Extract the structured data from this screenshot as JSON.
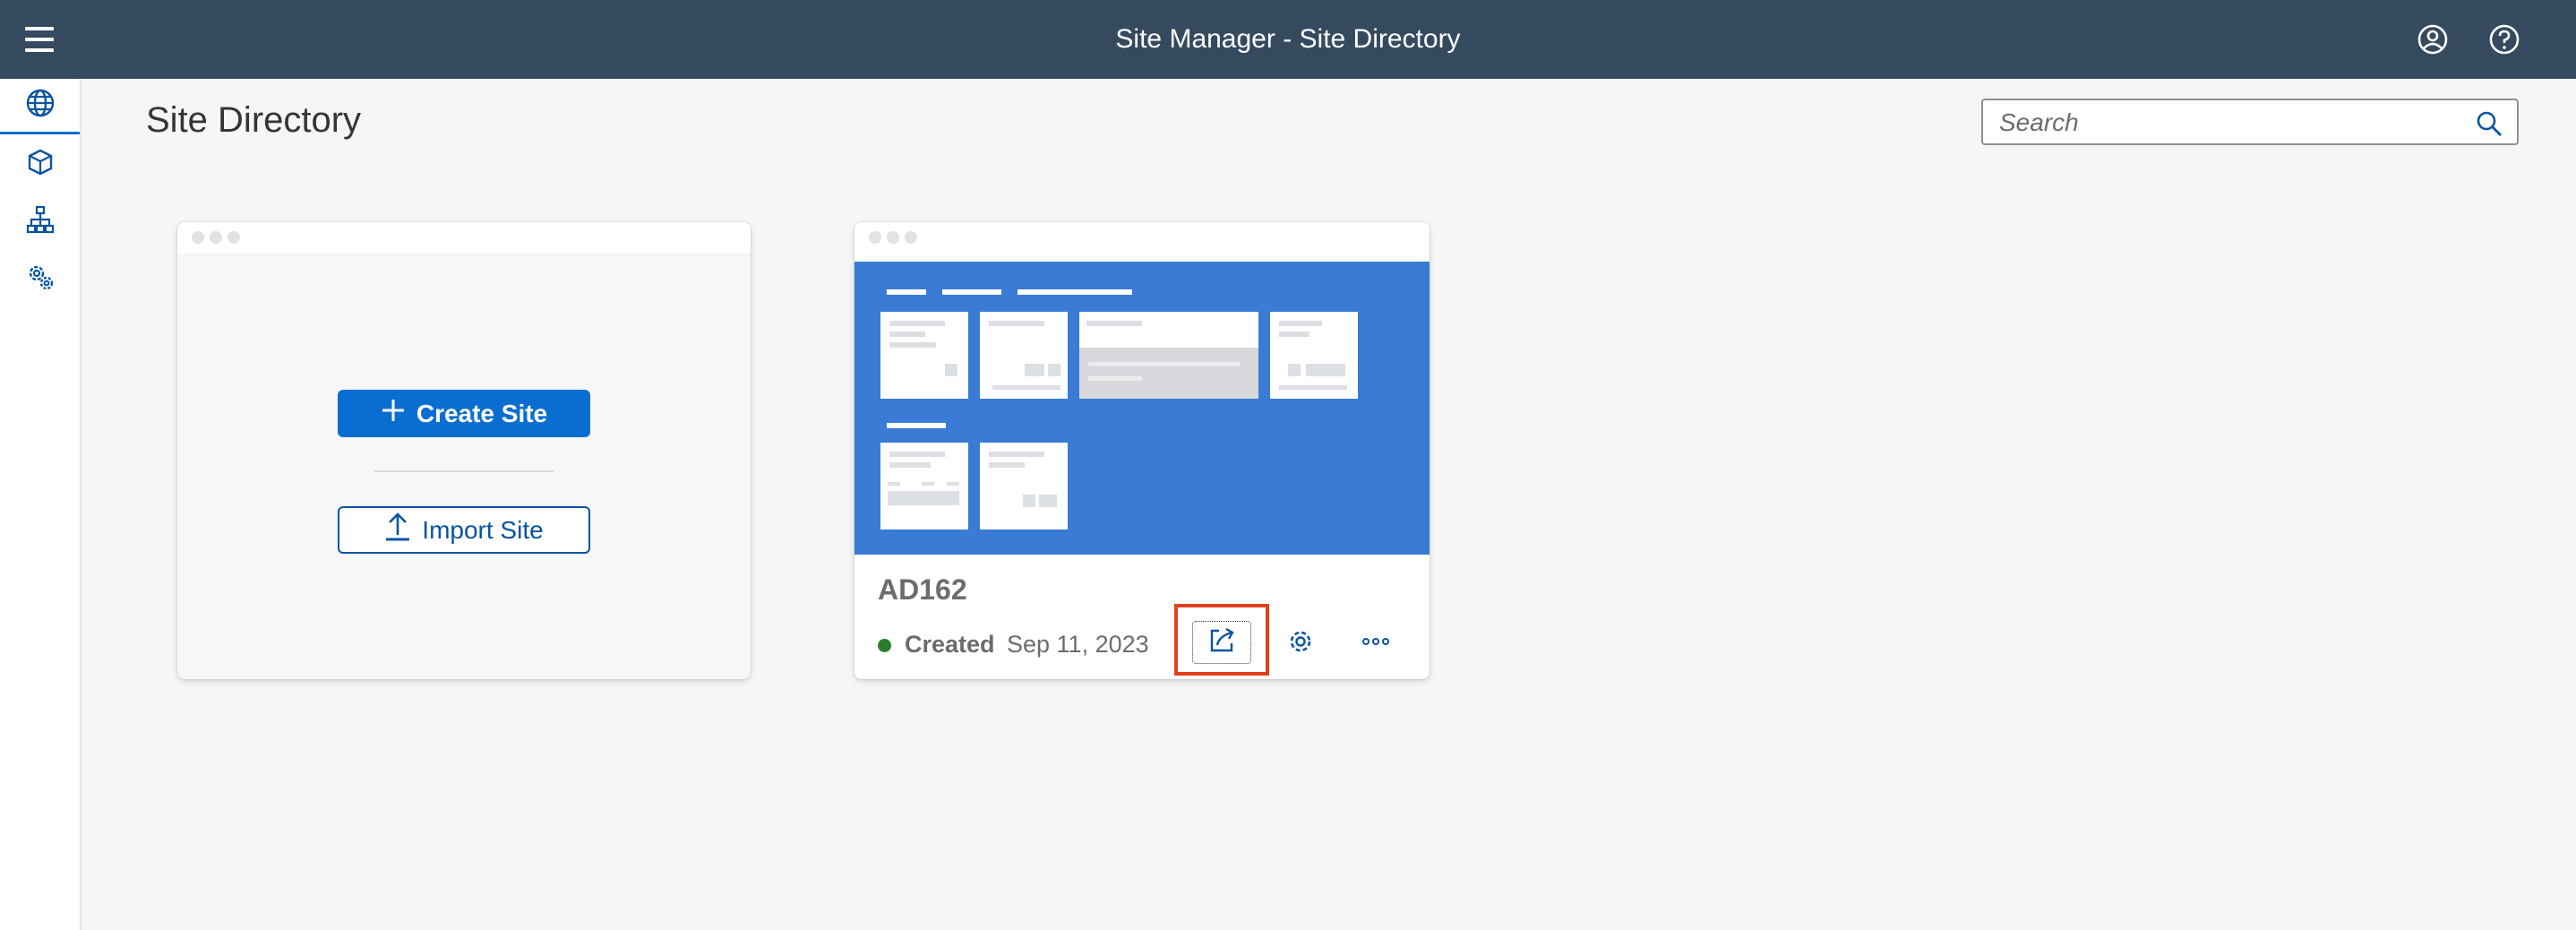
{
  "shell": {
    "title": "Site Manager - Site Directory",
    "icons": [
      "hamburger-menu-icon",
      "user-profile-icon",
      "help-icon"
    ]
  },
  "sidebar": {
    "items": [
      {
        "icon": "globe-icon",
        "active": true
      },
      {
        "icon": "content-cube-icon",
        "active": false
      },
      {
        "icon": "hierarchy-icon",
        "active": false
      },
      {
        "icon": "settings-gears-icon",
        "active": false
      }
    ]
  },
  "page": {
    "title": "Site Directory"
  },
  "search": {
    "placeholder": "Search"
  },
  "create_card": {
    "create_label": "Create Site",
    "import_label": "Import Site"
  },
  "site_card": {
    "name": "AD162",
    "status": "Created",
    "status_color": "#2b7d2b",
    "date": "Sep 11, 2023",
    "actions": [
      "open-site-icon",
      "gear-icon",
      "more-options-icon"
    ]
  },
  "colors": {
    "shell": "#354a5f",
    "accent": "#0a6ed1",
    "thumbnail": "#3a7bd5",
    "highlight": "#e0401e"
  }
}
